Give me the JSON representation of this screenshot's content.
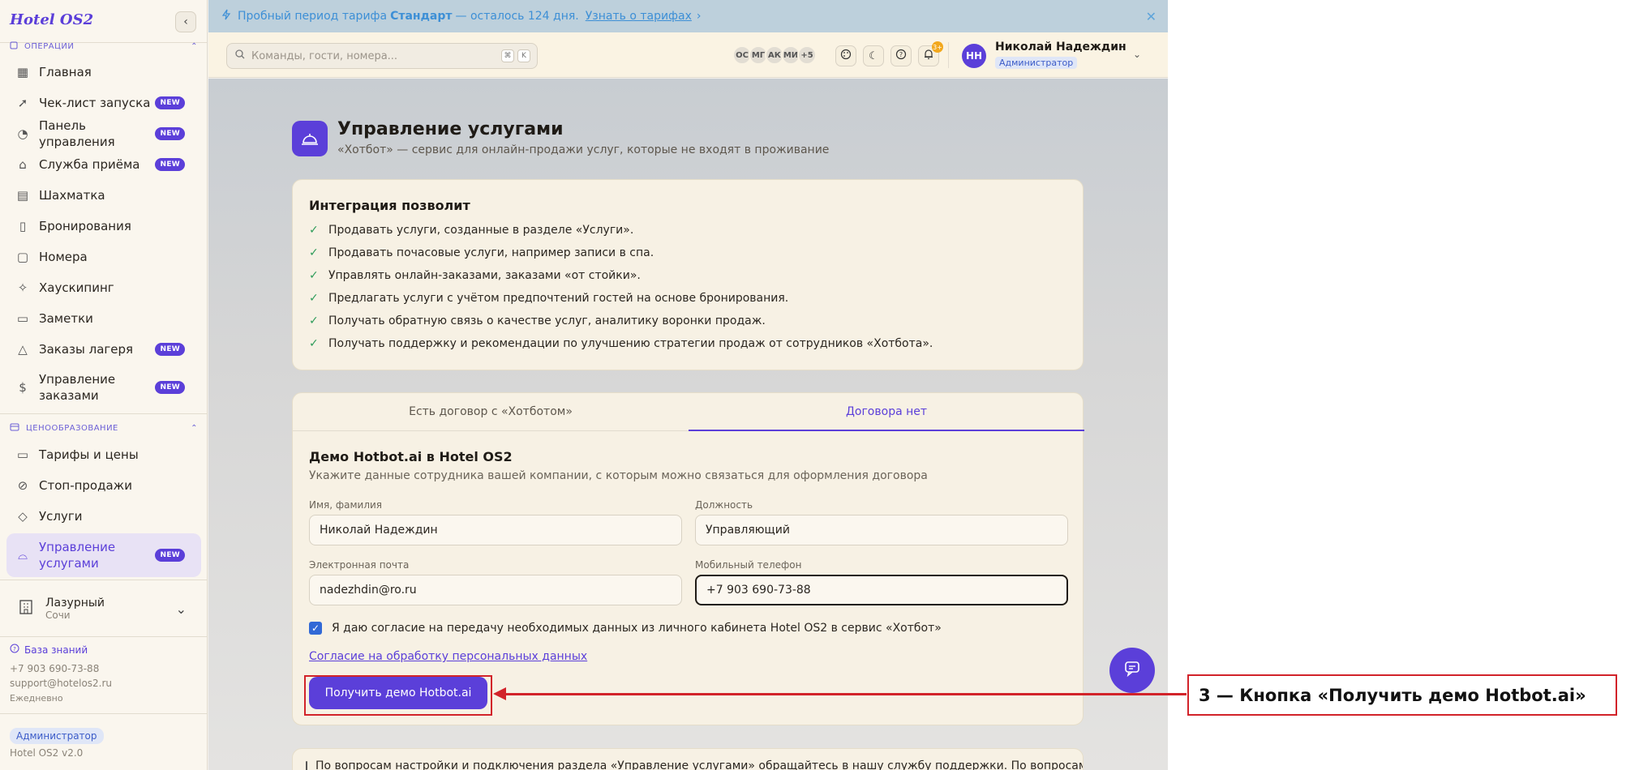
{
  "app": {
    "logo": "Hotel OS2",
    "collapse_icon": "chevron-left-icon"
  },
  "banner": {
    "prefix": "Пробный период тарифа",
    "plan": "Стандарт",
    "suffix": "— осталось 124 дня.",
    "link": "Узнать о тарифах",
    "color": "#3d8fd6",
    "bg": "#bdd0dc"
  },
  "topbar": {
    "search_placeholder": "Команды, гости, номера...",
    "search_keys": [
      "⌘",
      "K"
    ],
    "presence": [
      "ОС",
      "МГ",
      "АК",
      "МИ",
      "+5"
    ],
    "notifications_count": "3+",
    "user": {
      "initials": "НН",
      "name": "Николай Надеждин",
      "role": "Администратор"
    }
  },
  "sidebar": {
    "section_operations": "ОПЕРАЦИИ",
    "items_ops": [
      {
        "label": "Главная",
        "icon": "grid-icon",
        "new": false
      },
      {
        "label": "Чек-лист запуска",
        "icon": "rocket-icon",
        "new": true
      },
      {
        "label": "Панель управления",
        "icon": "gauge-icon",
        "new": true
      },
      {
        "label": "Служба приёма",
        "icon": "bell-icon",
        "new": true
      },
      {
        "label": "Шахматка",
        "icon": "table-icon",
        "new": false
      },
      {
        "label": "Бронирования",
        "icon": "clipboard-icon",
        "new": false
      },
      {
        "label": "Номера",
        "icon": "door-icon",
        "new": false
      },
      {
        "label": "Хаускипинг",
        "icon": "sparkle-icon",
        "new": false
      },
      {
        "label": "Заметки",
        "icon": "note-icon",
        "new": false
      },
      {
        "label": "Заказы лагеря",
        "icon": "tent-icon",
        "new": true
      },
      {
        "label": "Управление заказами",
        "icon": "receipt-icon",
        "new": true
      }
    ],
    "section_pricing": "ЦЕНООБРАЗОВАНИЕ",
    "items_pricing": [
      {
        "label": "Тарифы и цены",
        "icon": "card-icon",
        "new": false
      },
      {
        "label": "Стоп-продажи",
        "icon": "ban-icon",
        "new": false
      },
      {
        "label": "Услуги",
        "icon": "tag-icon",
        "new": false
      },
      {
        "label": "Управление услугами",
        "icon": "service-bell-icon",
        "new": true,
        "active": true
      }
    ],
    "new_badge": "NEW",
    "hotel": {
      "name": "Лазурный",
      "city": "Сочи"
    },
    "kb_link": "База знаний",
    "phone": "+7 903 690-73-88",
    "email": "support@hotelos2.ru",
    "hours": "Ежедневно",
    "role": "Администратор",
    "version": "Hotel OS2 v2.0"
  },
  "page": {
    "title": "Управление услугами",
    "subtitle": "«Хотбот» — сервис для онлайн-продажи услуг, которые не входят в проживание",
    "benefits_title": "Интеграция позволит",
    "benefits": [
      "Продавать услуги, созданные в разделе «Услуги».",
      "Продавать почасовые услуги, например записи в спа.",
      "Управлять онлайн-заказами, заказами «от стойки».",
      "Предлагать услуги с учётом предпочтений гостей на основе бронирования.",
      "Получать обратную связь о качестве услуг, аналитику воронки продаж.",
      "Получать поддержку и рекомендации по улучшению стратегии продаж от сотрудников «Хотбота»."
    ],
    "tabs": [
      "Есть договор с «Хотботом»",
      "Договора нет"
    ],
    "active_tab": 1,
    "form": {
      "title": "Демо Hotbot.ai в Hotel OS2",
      "subtitle": "Укажите данные сотрудника вашей компании, с которым можно связаться для оформления договора",
      "name_label": "Имя, фамилия",
      "name_value": "Николай Надеждин",
      "position_label": "Должность",
      "position_value": "Управляющий",
      "email_label": "Электронная почта",
      "email_value": "nadezhdin@ro.ru",
      "phone_label": "Мобильный телефон",
      "phone_value": "+7 903 690-73-88",
      "consent_checked": true,
      "consent_text": "Я даю согласие на передачу необходимых данных из личного кабинета Hotel OS2 в сервис «Хотбот»",
      "pd_link": "Согласие на обработку персональных данных",
      "submit": "Получить демо Hotbot.ai"
    },
    "support_text": "По вопросам настройки и подключения раздела «Управление услугами» обращайтесь в нашу службу поддержки. По вопросам"
  },
  "annotation": {
    "label": "3 — Кнопка «Получить демо Hotbot.ai»",
    "color": "#d2232a"
  },
  "colors": {
    "accent": "#5b3fd9",
    "success": "#2e9c5a"
  }
}
